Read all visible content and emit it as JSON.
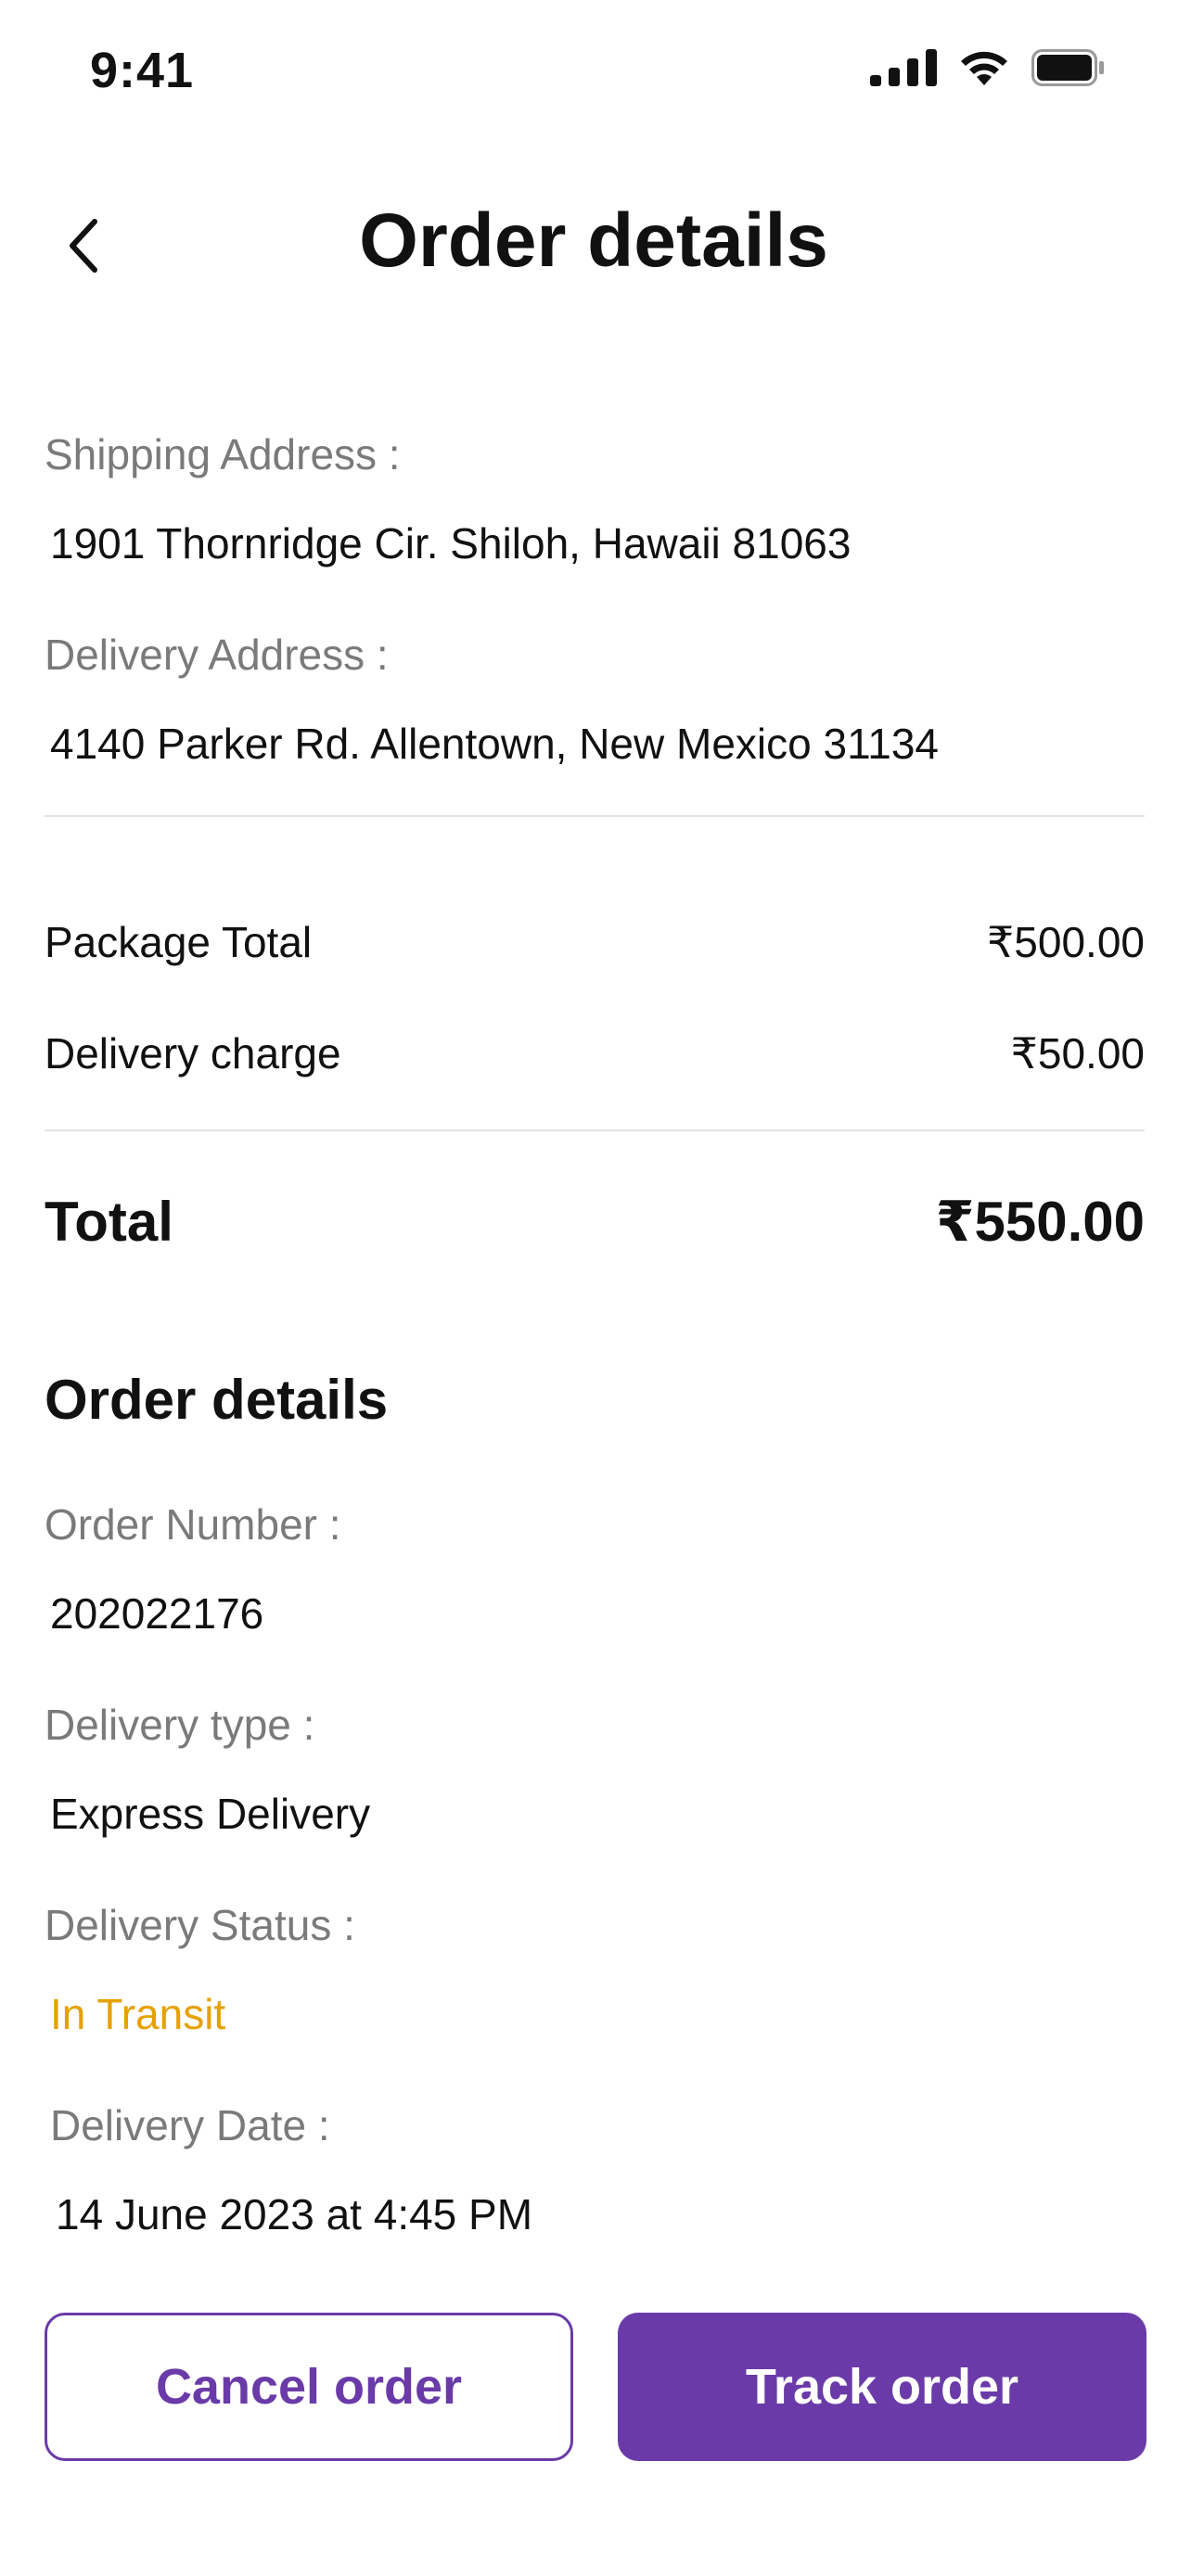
{
  "status_bar": {
    "time": "9:41"
  },
  "header": {
    "title": "Order details",
    "back_icon": "chevron-left-icon"
  },
  "addresses": {
    "shipping_label": "Shipping Address :",
    "shipping_value": "1901 Thornridge Cir. Shiloh, Hawaii 81063",
    "delivery_label": "Delivery Address :",
    "delivery_value": "4140 Parker Rd. Allentown, New Mexico 31134"
  },
  "charges": {
    "package_total_label": "Package Total",
    "package_total_value": "₹500.00",
    "delivery_charge_label": "Delivery charge",
    "delivery_charge_value": "₹50.00",
    "total_label": "Total",
    "total_value": "₹550.00"
  },
  "order_details": {
    "section_title": "Order details",
    "order_number_label": "Order Number :",
    "order_number_value": "202022176",
    "delivery_type_label": "Delivery type :",
    "delivery_type_value": "Express Delivery",
    "delivery_status_label": "Delivery Status :",
    "delivery_status_value": "In Transit",
    "delivery_date_label": "Delivery Date :",
    "delivery_date_value": "14 June 2023 at 4:45 PM"
  },
  "actions": {
    "cancel_label": "Cancel order",
    "track_label": "Track order"
  },
  "colors": {
    "accent": "#6A3BA8",
    "status_in_transit": "#E5A100",
    "label_gray": "#7a7a7a",
    "divider": "#e2e2e2"
  }
}
